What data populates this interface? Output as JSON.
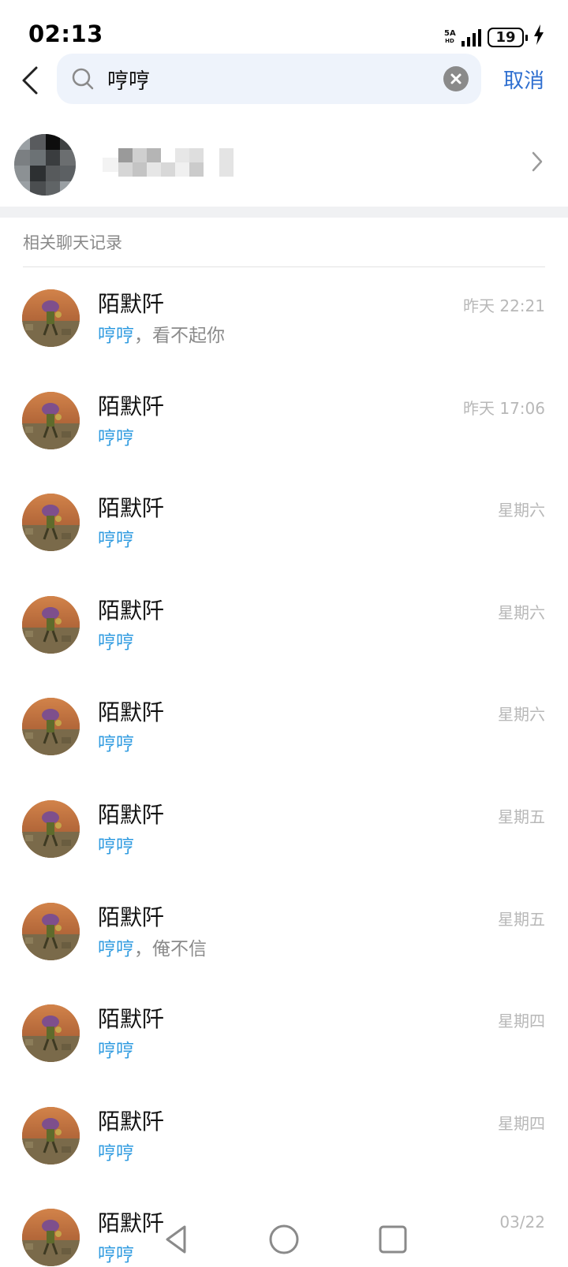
{
  "status_bar": {
    "time": "02:13",
    "network_top": "5A",
    "network_bottom": "HD",
    "battery": "19"
  },
  "search": {
    "query": "哼哼",
    "cancel_label": "取消"
  },
  "section": {
    "title": "相关聊天记录"
  },
  "results": [
    {
      "name": "陌默阡",
      "time": "昨天 22:21",
      "keyword": "哼哼",
      "rest": "，看不起你"
    },
    {
      "name": "陌默阡",
      "time": "昨天 17:06",
      "keyword": "哼哼",
      "rest": ""
    },
    {
      "name": "陌默阡",
      "time": "星期六",
      "keyword": "哼哼",
      "rest": ""
    },
    {
      "name": "陌默阡",
      "time": "星期六",
      "keyword": "哼哼",
      "rest": ""
    },
    {
      "name": "陌默阡",
      "time": "星期六",
      "keyword": "哼哼",
      "rest": ""
    },
    {
      "name": "陌默阡",
      "time": "星期五",
      "keyword": "哼哼",
      "rest": ""
    },
    {
      "name": "陌默阡",
      "time": "星期五",
      "keyword": "哼哼",
      "rest": "，俺不信"
    },
    {
      "name": "陌默阡",
      "time": "星期四",
      "keyword": "哼哼",
      "rest": ""
    },
    {
      "name": "陌默阡",
      "time": "星期四",
      "keyword": "哼哼",
      "rest": ""
    },
    {
      "name": "陌默阡",
      "time": "03/22",
      "keyword": "哼哼",
      "rest": ""
    }
  ],
  "icons": {
    "back": "chevron-left-icon",
    "search": "search-icon",
    "clear": "clear-icon",
    "chevron": "chevron-right-icon",
    "nav_back": "triangle-back-icon",
    "nav_home": "circle-home-icon",
    "nav_recents": "square-recents-icon"
  },
  "colors": {
    "accent": "#2f6fd0",
    "keyword": "#2f9be0",
    "search_bg": "#eef3fb",
    "muted": "#8a8a8a"
  }
}
